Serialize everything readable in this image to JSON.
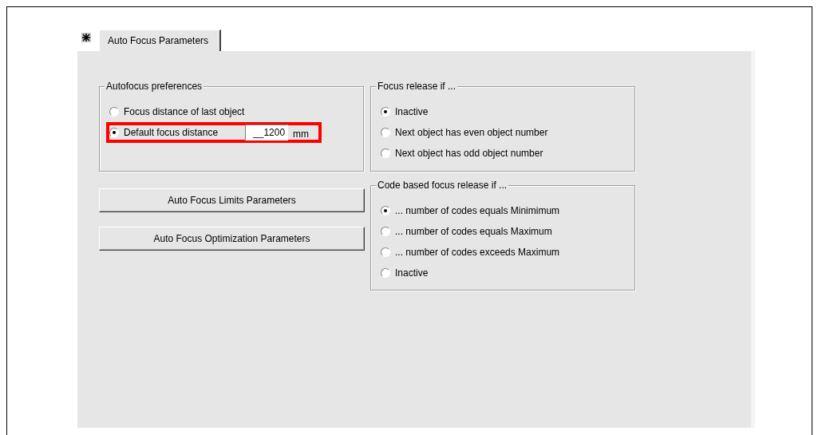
{
  "tab": {
    "label": "Auto Focus Parameters",
    "selected": true
  },
  "preferences_group": {
    "legend": "Autofocus preferences",
    "options": [
      {
        "label": "Focus distance of last object",
        "selected": false,
        "highlighted": false
      },
      {
        "label": "Default focus distance",
        "selected": true,
        "highlighted": true,
        "field": {
          "value": "__1200",
          "unit": "mm"
        }
      }
    ]
  },
  "buttons": [
    "Auto Focus Limits Parameters",
    "Auto Focus Optimization Parameters"
  ],
  "focus_release_group": {
    "legend": "Focus release if ...",
    "options": [
      {
        "label": "Inactive",
        "selected": true,
        "highlighted": false
      },
      {
        "label": "Next object has even object number",
        "selected": false,
        "highlighted": false
      },
      {
        "label": "Next object has odd object number",
        "selected": false,
        "highlighted": false
      }
    ]
  },
  "code_release_group": {
    "legend": "Code based focus release if ...",
    "options": [
      {
        "label": "... number of codes equals Minimimum",
        "selected": true,
        "highlighted": false
      },
      {
        "label": "... number of codes equals Maximum",
        "selected": false,
        "highlighted": false
      },
      {
        "label": "... number of codes exceeds Maximum",
        "selected": false,
        "highlighted": false
      },
      {
        "label": "Inactive",
        "selected": false,
        "highlighted": false
      }
    ]
  }
}
